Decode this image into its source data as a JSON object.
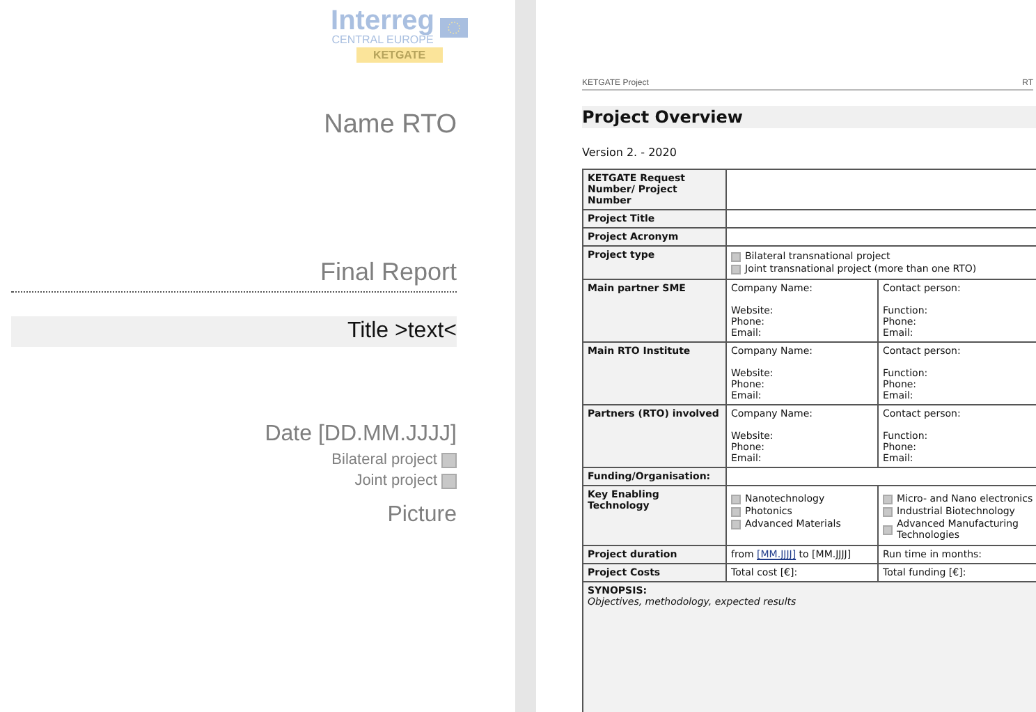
{
  "left_page": {
    "logo": {
      "title": "Interreg",
      "subtitle": "CENTRAL EUROPE",
      "badge": "KETGATE"
    },
    "name": "Name RTO",
    "report": "Final Report",
    "title": "Title >text<",
    "date": "Date [DD.MM.JJJJ]",
    "options": [
      {
        "label": "Bilateral project",
        "checked": false
      },
      {
        "label": "Joint project",
        "checked": false
      }
    ],
    "picture": "Picture"
  },
  "right_page": {
    "header": {
      "left": "KETGATE Project",
      "right": "RT"
    },
    "heading": "Project Overview",
    "version": "Version 2. - 2020",
    "rows": [
      {
        "kind": "blank",
        "label": "KETGATE Request Number/ Project Number"
      },
      {
        "kind": "blank",
        "label": "Project Title"
      },
      {
        "kind": "blank",
        "label": "Project Acronym"
      },
      {
        "kind": "checks",
        "label": "Project type",
        "options": [
          {
            "label": "Bilateral transnational project",
            "checked": false
          },
          {
            "label": "Joint transnational project (more than one RTO)",
            "checked": false
          }
        ]
      },
      {
        "kind": "contact",
        "label": "Main partner SME",
        "left": {
          "first": "Company Name:",
          "lines": [
            "Website:",
            "Phone:",
            "Email:"
          ]
        },
        "right": {
          "first": "Contact person:",
          "lines": [
            "Function:",
            "Phone:",
            "Email:"
          ]
        }
      },
      {
        "kind": "contact",
        "label": "Main RTO Institute",
        "left": {
          "first": "Company Name:",
          "lines": [
            "Website:",
            "Phone:",
            "Email:"
          ]
        },
        "right": {
          "first": "Contact person:",
          "lines": [
            "Function:",
            "Phone:",
            "Email:"
          ]
        }
      },
      {
        "kind": "contact",
        "label": "Partners (RTO) involved",
        "left": {
          "first": "Company Name:",
          "lines": [
            "Website:",
            "Phone:",
            "Email:"
          ]
        },
        "right": {
          "first": "Contact person:",
          "lines": [
            "Function:",
            "Phone:",
            "Email:"
          ]
        }
      },
      {
        "kind": "blank",
        "label": "Funding/Organisation:"
      },
      {
        "kind": "ket",
        "label": "Key Enabling Technology",
        "left": [
          {
            "label": "Nanotechnology",
            "checked": false
          },
          {
            "label": "Photonics",
            "checked": false
          },
          {
            "label": "Advanced Materials",
            "checked": false
          }
        ],
        "right": [
          {
            "label": "Micro- and Nano electronics",
            "checked": false
          },
          {
            "label": "Industrial Biotechnology",
            "checked": false
          },
          {
            "label": "Advanced Manufacturing Technologies",
            "checked": false
          }
        ]
      },
      {
        "kind": "duration",
        "label": "Project duration",
        "prefix": "from",
        "field": "[MM.JJJJ]",
        "suffix": "to [MM.JJJJ]",
        "right": "Run time in months:"
      },
      {
        "kind": "pair",
        "label": "Project Costs",
        "left": "Total cost [€]:",
        "right": "Total funding [€]:"
      },
      {
        "kind": "note",
        "label": "SYNOPSIS:",
        "note": "Objectives, methodology, expected results"
      }
    ]
  }
}
